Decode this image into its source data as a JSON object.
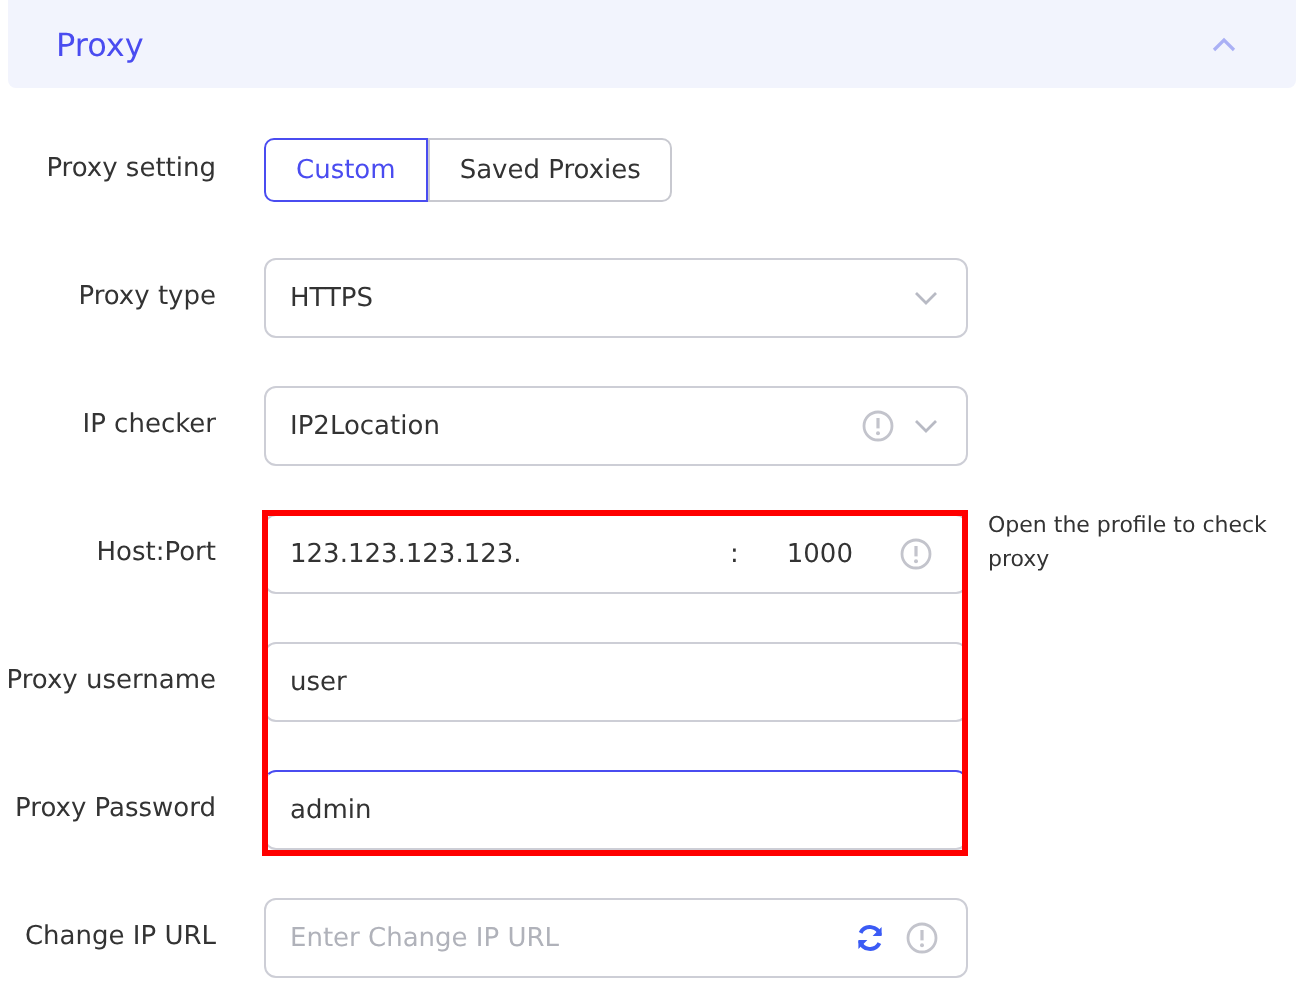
{
  "section": {
    "title": "Proxy",
    "expanded": true
  },
  "fields": [
    {
      "kind": "segmented",
      "label": "Proxy setting",
      "options": [
        {
          "label": "Custom",
          "selected": true
        },
        {
          "label": "Saved Proxies",
          "selected": false
        }
      ],
      "highlighted": false
    },
    {
      "kind": "select",
      "label": "Proxy type",
      "value": "HTTPS",
      "info": false,
      "highlighted": false
    },
    {
      "kind": "select",
      "label": "IP checker",
      "value": "IP2Location",
      "info": true,
      "highlighted": false
    },
    {
      "kind": "host_port",
      "label": "Host:Port",
      "host": "123.123.123.123.",
      "separator": ":",
      "port": "1000",
      "note": "Open the profile to check proxy",
      "highlighted": true
    },
    {
      "kind": "input",
      "label": "Proxy username",
      "value": "user",
      "focused": false,
      "highlighted": true
    },
    {
      "kind": "input",
      "label": "Proxy Password",
      "value": "admin",
      "focused": true,
      "highlighted": true
    },
    {
      "kind": "url",
      "label": "Change IP URL",
      "placeholder": "Enter Change IP URL",
      "highlighted": false
    }
  ]
}
